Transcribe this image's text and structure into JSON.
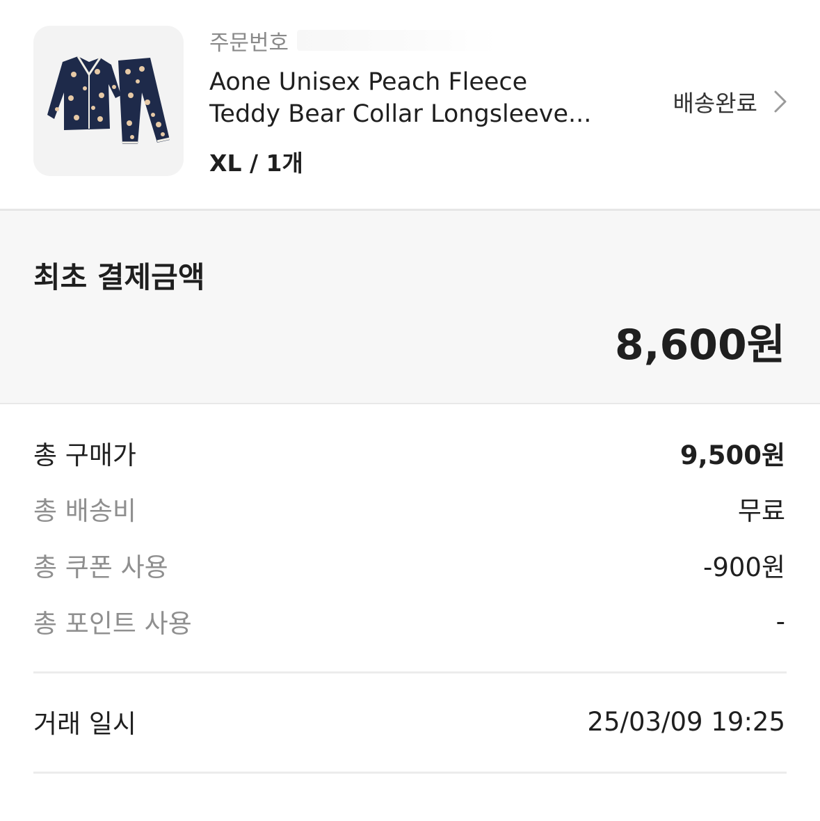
{
  "order": {
    "order_no_label": "주문번호",
    "product_name_line1": "Aone Unisex Peach Fleece",
    "product_name_line2": "Teddy Bear Collar Longsleeve...",
    "option": "XL / 1개",
    "status": "배송완료",
    "product_image_icon": "pajama-set-image",
    "chevron_icon": "chevron-right-icon"
  },
  "payment": {
    "title": "최초 결제금액",
    "amount": "8,600원"
  },
  "details": [
    {
      "label": "총 구매가",
      "value": "9,500원"
    },
    {
      "label": "총 배송비",
      "value": "무료"
    },
    {
      "label": "총 쿠폰 사용",
      "value": "-900원"
    },
    {
      "label": "총 포인트 사용",
      "value": "-"
    }
  ],
  "transaction": {
    "label": "거래 일시",
    "value": "25/03/09 19:25"
  },
  "colors": {
    "page_bg": "#ffffff",
    "panel_bg": "#f7f7f7",
    "muted_text": "#8f8f8f",
    "product_navy": "#1e2a4a"
  }
}
